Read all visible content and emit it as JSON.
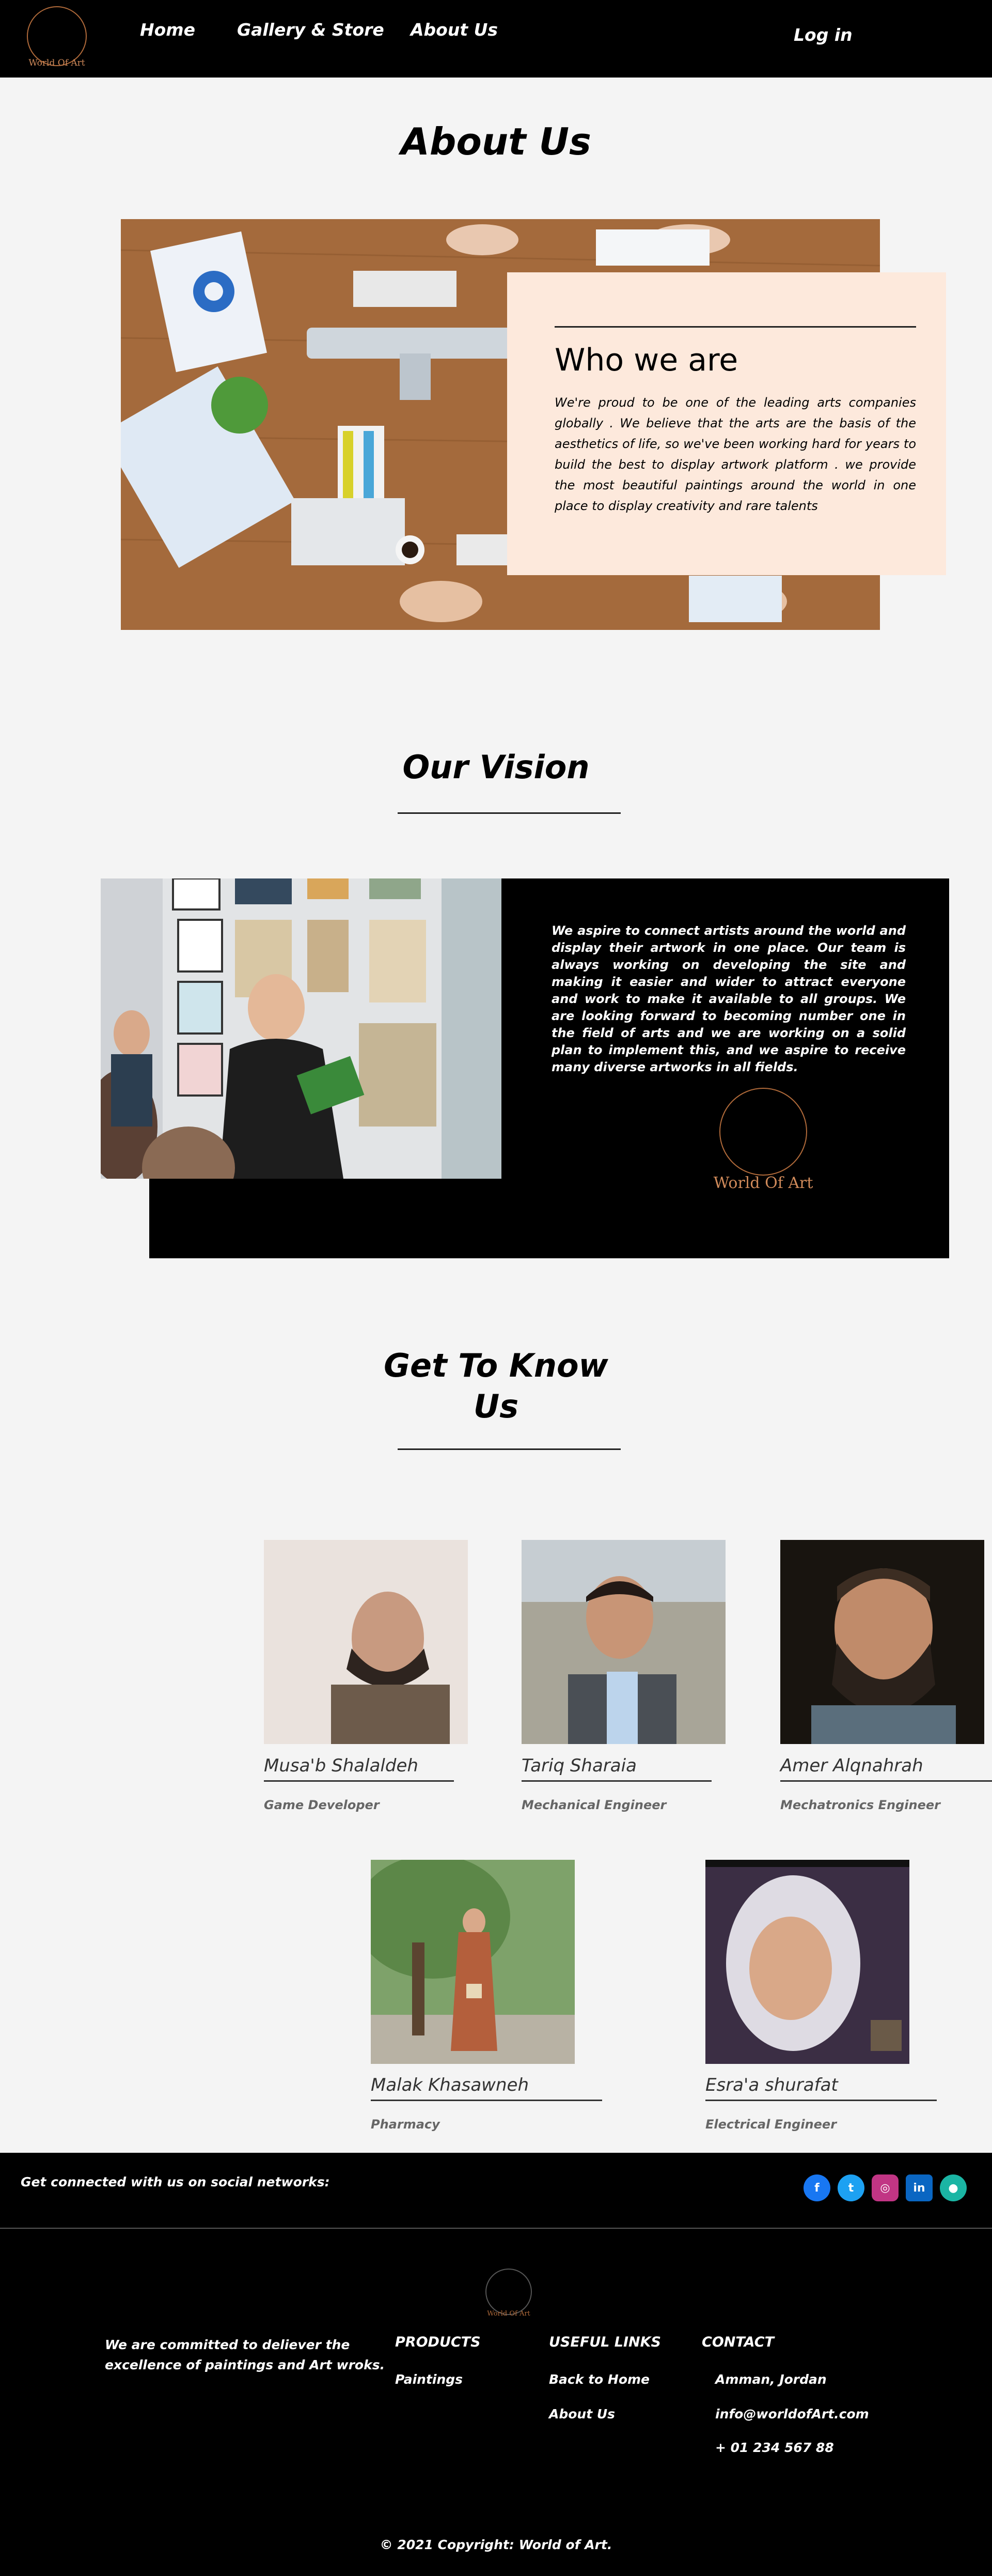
{
  "nav": {
    "logo_text": "World Of Art",
    "links": [
      "Home",
      "Gallery & Store",
      "About Us"
    ],
    "login": "Log in"
  },
  "about": {
    "title": "About Us",
    "who_title": "Who we are",
    "who_text": "We're proud to be one of the leading arts companies globally . We believe that the arts are the basis of the aesthetics of life, so we've been working hard for years to build the best to display artwork platform . we provide the most beautiful paintings around the world in one place to display creativity and rare talents"
  },
  "vision": {
    "title": "Our Vision",
    "text": "We aspire to connect artists around the world and display their artwork in one place. Our team is always working on developing the site and making it easier and wider to attract everyone and work to make it available to all groups. We are looking forward to becoming number one in the field of arts and we are working on a solid plan to implement this, and we aspire to receive many diverse artworks in all fields.",
    "logo_text": "World Of Art"
  },
  "team": {
    "title_line1": "Get To Know",
    "title_line2": "Us",
    "members": [
      {
        "name": "Musa'b Shalaldeh",
        "role": "Game Developer"
      },
      {
        "name": "Tariq Sharaia",
        "role": "Mechanical Engineer"
      },
      {
        "name": "Amer Alqnahrah",
        "role": "Mechatronics Engineer"
      },
      {
        "name": "Malak Khasawneh",
        "role": "Pharmacy"
      },
      {
        "name": "Esra'a shurafat",
        "role": "Electrical Engineer"
      }
    ]
  },
  "social": {
    "text": "Get connected with us on social networks:",
    "icons": [
      {
        "name": "facebook-icon",
        "glyph": "f",
        "color": "#1877f2"
      },
      {
        "name": "twitter-icon",
        "glyph": "t",
        "color": "#1da1f2"
      },
      {
        "name": "instagram-icon",
        "glyph": "◎",
        "color": "#c13584"
      },
      {
        "name": "linkedin-icon",
        "glyph": "in",
        "color": "#0a66c2"
      },
      {
        "name": "github-icon",
        "glyph": "●",
        "color": "#1bb5a4"
      }
    ]
  },
  "footer": {
    "logo_text": "World Of Art",
    "tagline_line1": "We are committed to deliever the",
    "tagline_line2": "excellence of paintings and Art wroks.",
    "products_title": "PRODUCTS",
    "products": [
      "Paintings"
    ],
    "links_title": "USEFUL LINKS",
    "links": [
      "Back to Home",
      "About Us"
    ],
    "contact_title": "CONTACT",
    "contact": [
      "Amman, Jordan",
      "info@worldofArt.com",
      "+ 01 234 567 88"
    ],
    "copyright": "© 2021 Copyright: World of Art."
  }
}
